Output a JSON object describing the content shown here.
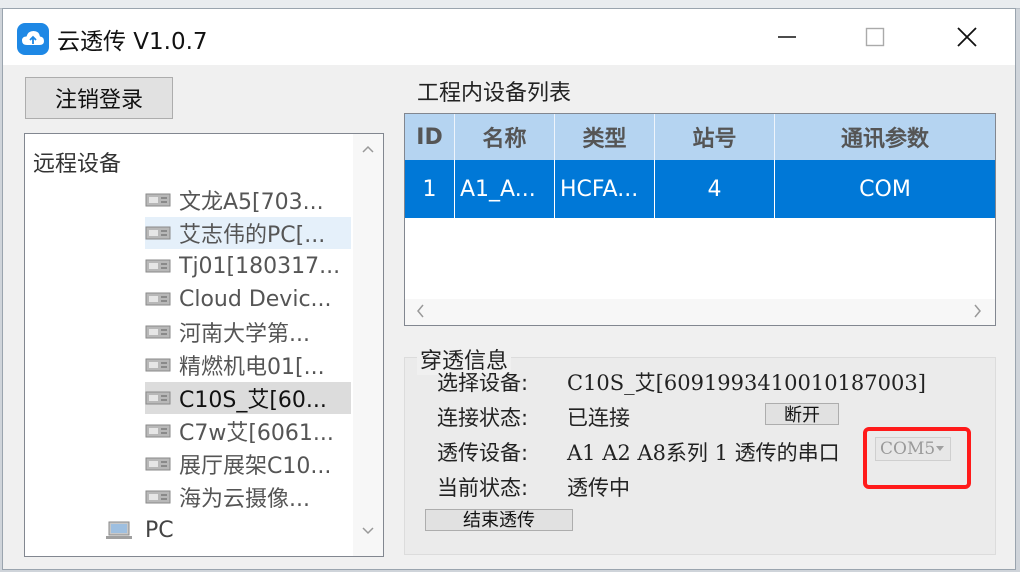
{
  "window": {
    "title": "云透传 V1.0.7"
  },
  "toolbar": {
    "logout_label": "注销登录"
  },
  "tree": {
    "header": "远程设备",
    "items": [
      {
        "label": "文龙A5[703..."
      },
      {
        "label": "艾志伟的PC[..."
      },
      {
        "label": "Tj01[180317..."
      },
      {
        "label": "Cloud Devic..."
      },
      {
        "label": "河南大学第..."
      },
      {
        "label": "精燃机电01[..."
      },
      {
        "label": "C10S_艾[60..."
      },
      {
        "label": "C7w艾[6061..."
      },
      {
        "label": "展厅展架C10..."
      },
      {
        "label": "海为云摄像..."
      }
    ],
    "pc_label": "PC"
  },
  "device_list": {
    "title": "工程内设备列表",
    "columns": [
      "ID",
      "名称",
      "类型",
      "站号",
      "通讯参数"
    ],
    "rows": [
      {
        "id": "1",
        "name": "A1_A...",
        "type": "HCFA...",
        "station": "4",
        "comm": "COM"
      }
    ]
  },
  "passthrough": {
    "title": "穿透信息",
    "select_device_label": "选择设备:",
    "select_device_value": "C10S_艾[6091993410010187003]",
    "connection_label": "连接状态:",
    "connection_value": "已连接",
    "disconnect_label": "断开",
    "device_label": "透传设备:",
    "device_value": "A1 A2 A8系列 1 透传的串口",
    "com_value": "COM5",
    "current_label": "当前状态:",
    "current_value": "透传中",
    "end_label": "结束透传"
  },
  "colors": {
    "accent": "#0078d7",
    "header_bg": "#b5d4f1",
    "highlight": "#ff1a1a"
  }
}
